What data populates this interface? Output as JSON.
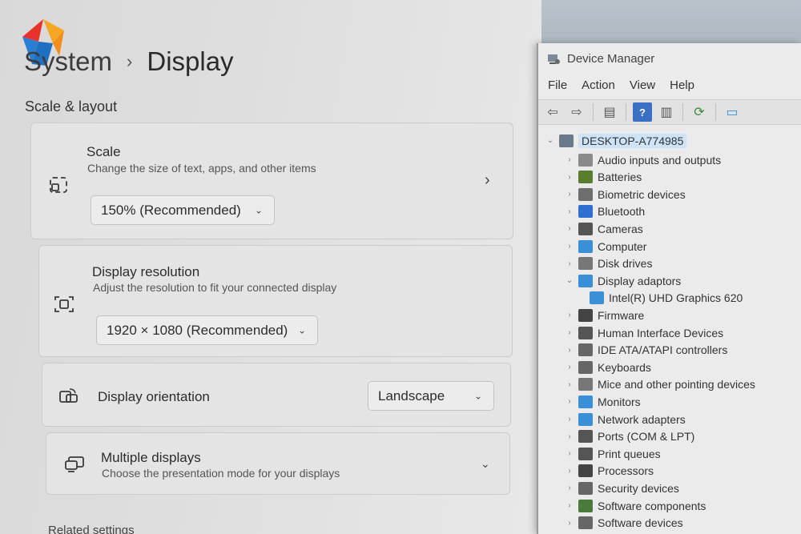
{
  "settings": {
    "breadcrumb": {
      "parent": "System",
      "current": "Display"
    },
    "section_title": "Scale & layout",
    "scale": {
      "title": "Scale",
      "subtitle": "Change the size of text, apps, and other items",
      "value": "150% (Recommended)",
      "icon": "scale-icon"
    },
    "resolution": {
      "title": "Display resolution",
      "subtitle": "Adjust the resolution to fit your connected display",
      "value": "1920 × 1080 (Recommended)",
      "icon": "resolution-icon"
    },
    "orientation": {
      "title": "Display orientation",
      "value": "Landscape",
      "icon": "orientation-icon"
    },
    "multiple": {
      "title": "Multiple displays",
      "subtitle": "Choose the presentation mode for your displays",
      "icon": "multiple-displays-icon"
    },
    "related": "Related settings"
  },
  "device_manager": {
    "title": "Device Manager",
    "menu": [
      "File",
      "Action",
      "View",
      "Help"
    ],
    "root": "DESKTOP-A774985",
    "items": [
      {
        "label": "Audio inputs and outputs",
        "icon": "speaker-icon",
        "color": "#8a8a8a"
      },
      {
        "label": "Batteries",
        "icon": "battery-icon",
        "color": "#5a7d2e"
      },
      {
        "label": "Biometric devices",
        "icon": "fingerprint-icon",
        "color": "#6e6e6e"
      },
      {
        "label": "Bluetooth",
        "icon": "bluetooth-icon",
        "color": "#2e6fd1"
      },
      {
        "label": "Cameras",
        "icon": "camera-icon",
        "color": "#555555"
      },
      {
        "label": "Computer",
        "icon": "computer-icon",
        "color": "#3a8fd6"
      },
      {
        "label": "Disk drives",
        "icon": "disk-icon",
        "color": "#777777"
      },
      {
        "label": "Display adaptors",
        "icon": "display-icon",
        "color": "#3a8fd6",
        "expanded": true
      },
      {
        "label": "Intel(R) UHD Graphics 620",
        "icon": "monitor-icon",
        "color": "#3a8fd6",
        "child": true
      },
      {
        "label": "Firmware",
        "icon": "chip-icon",
        "color": "#444444"
      },
      {
        "label": "Human Interface Devices",
        "icon": "hid-icon",
        "color": "#555555"
      },
      {
        "label": "IDE ATA/ATAPI controllers",
        "icon": "ide-icon",
        "color": "#666666"
      },
      {
        "label": "Keyboards",
        "icon": "keyboard-icon",
        "color": "#666666"
      },
      {
        "label": "Mice and other pointing devices",
        "icon": "mouse-icon",
        "color": "#777777"
      },
      {
        "label": "Monitors",
        "icon": "monitor-icon",
        "color": "#3a8fd6"
      },
      {
        "label": "Network adapters",
        "icon": "network-icon",
        "color": "#3a8fd6"
      },
      {
        "label": "Ports (COM & LPT)",
        "icon": "port-icon",
        "color": "#555555"
      },
      {
        "label": "Print queues",
        "icon": "printer-icon",
        "color": "#555555"
      },
      {
        "label": "Processors",
        "icon": "processor-icon",
        "color": "#444444"
      },
      {
        "label": "Security devices",
        "icon": "security-icon",
        "color": "#666666"
      },
      {
        "label": "Software components",
        "icon": "software-icon",
        "color": "#4a7a3a"
      },
      {
        "label": "Software devices",
        "icon": "software-device-icon",
        "color": "#666666"
      }
    ]
  }
}
